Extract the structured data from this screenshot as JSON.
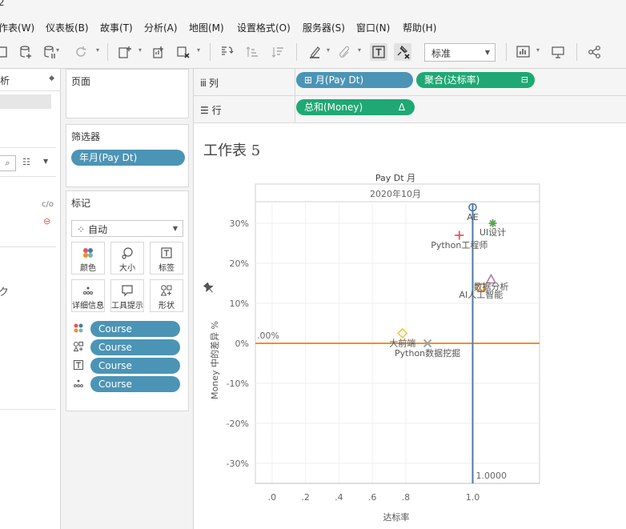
{
  "window": {
    "title_fragment": "2"
  },
  "menu": [
    {
      "label": "作表(W)"
    },
    {
      "label": "仪表板(B)"
    },
    {
      "label": "故事(T)"
    },
    {
      "label": "分析(A)"
    },
    {
      "label": "地图(M)"
    },
    {
      "label": "设置格式(O)"
    },
    {
      "label": "服务器(S)"
    },
    {
      "label": "窗口(N)"
    },
    {
      "label": "帮助(H)"
    }
  ],
  "toolbar": {
    "fit_mode": "标准"
  },
  "data_pane": {
    "header": "析"
  },
  "pages_card": {
    "title": "页面"
  },
  "filters_card": {
    "title": "筛选器",
    "pill": "年月(Pay Dt)"
  },
  "marks_card": {
    "title": "标记",
    "mark_type": "自动",
    "buttons": [
      "颜色",
      "大小",
      "标签",
      "详细信息",
      "工具提示",
      "形状"
    ],
    "fields": [
      {
        "role": "color",
        "icon": "color-dots-icon",
        "label": "Course"
      },
      {
        "role": "shape",
        "icon": "shape-icon",
        "label": "Course"
      },
      {
        "role": "label",
        "icon": "text-label-icon",
        "label": "Course"
      },
      {
        "role": "detail",
        "icon": "detail-dots-icon",
        "label": "Course"
      }
    ]
  },
  "columns_shelf": {
    "label": "列",
    "pills": [
      {
        "text": "月(Pay Dt)"
      },
      {
        "text": "聚合(达标率)"
      }
    ]
  },
  "rows_shelf": {
    "label": "行",
    "pills": [
      {
        "text": "总和(Money)"
      }
    ]
  },
  "sheet": {
    "title": "工作表 5"
  },
  "chart_data": {
    "type": "scatter",
    "header_field": "Pay Dt 月",
    "header_value": "2020年10月",
    "xlabel": "达标率",
    "ylabel": "Money 中的差异 %",
    "xlim": [
      0.35,
      1.2
    ],
    "ylim": [
      -0.35,
      0.35
    ],
    "x_ticks": [
      {
        "v": 0.4,
        "t": ".0"
      },
      {
        "v": 0.5,
        "t": ".2"
      },
      {
        "v": 0.6,
        "t": ".4"
      },
      {
        "v": 0.7,
        "t": ".6"
      },
      {
        "v": 0.8,
        "t": ".8"
      },
      {
        "v": 1.0,
        "t": "1.0"
      }
    ],
    "y_ticks": [
      {
        "v": 0.3,
        "t": "30%"
      },
      {
        "v": 0.2,
        "t": "20%"
      },
      {
        "v": 0.1,
        "t": "10%"
      },
      {
        "v": 0.0,
        "t": "0%"
      },
      {
        "v": -0.1,
        "t": "-10%"
      },
      {
        "v": -0.2,
        "t": "-20%"
      },
      {
        "v": -0.3,
        "t": "-30%"
      }
    ],
    "reference_lines": [
      {
        "axis": "y",
        "value": 0.0,
        "label": ".00%",
        "color": "#f28e2b"
      },
      {
        "axis": "x",
        "value": 1.0,
        "label": "1.0000",
        "color": "#4e79a7"
      }
    ],
    "points": [
      {
        "course": "AE",
        "x": 1.0,
        "y": 0.34,
        "shape": "circle",
        "color": "#4e79a7"
      },
      {
        "course": "UI设计",
        "x": 1.06,
        "y": 0.3,
        "shape": "asterisk",
        "color": "#59a14f"
      },
      {
        "course": "Python工程师",
        "x": 0.96,
        "y": 0.27,
        "shape": "plus",
        "color": "#e15759"
      },
      {
        "course": "数据分析",
        "x": 1.055,
        "y": 0.16,
        "shape": "triangle",
        "color": "#b07aa1"
      },
      {
        "course": "AI人工智能",
        "x": 1.025,
        "y": 0.14,
        "shape": "square",
        "color": "#f28e2b"
      },
      {
        "course": "大前端",
        "x": 0.79,
        "y": 0.025,
        "shape": "diamond",
        "color": "#edc948"
      },
      {
        "course": "Python数据挖掘",
        "x": 0.865,
        "y": 0.0,
        "shape": "cross",
        "color": "#9ca3a8"
      }
    ]
  }
}
